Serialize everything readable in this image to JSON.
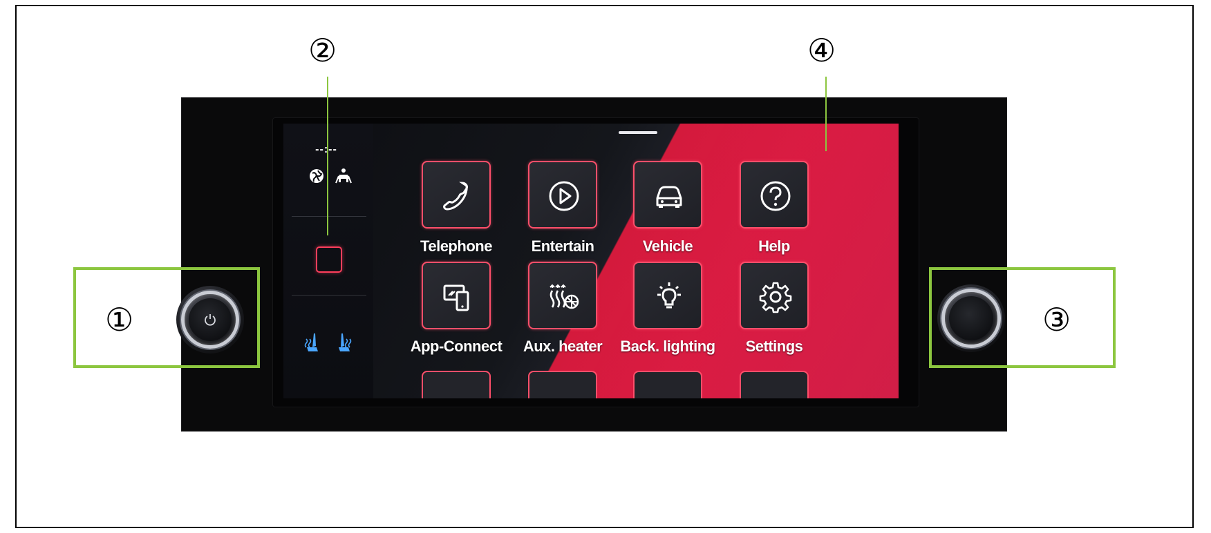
{
  "callouts": {
    "one": "①",
    "two": "②",
    "three": "③",
    "four": "④"
  },
  "colors": {
    "callout_green": "#8cc63f",
    "tile_border": "#ff4f6a",
    "screen_red": "#e31d45",
    "seat_icon_blue": "#4aa6ff"
  },
  "sidebar": {
    "time": "--:--",
    "icons": [
      "globe-icon",
      "traffic-assist-icon"
    ],
    "seat_icons": [
      "seat-heater-left-icon",
      "seat-heater-right-icon"
    ]
  },
  "apps": [
    {
      "label": "Telephone",
      "icon": "phone-icon"
    },
    {
      "label": "Entertain",
      "icon": "play-icon"
    },
    {
      "label": "Vehicle",
      "icon": "car-icon"
    },
    {
      "label": "Help",
      "icon": "help-icon"
    },
    {
      "label": "App-Connect",
      "icon": "app-connect-icon"
    },
    {
      "label": "Aux. heater",
      "icon": "aux-heater-icon"
    },
    {
      "label": "Back. lighting",
      "icon": "lightbulb-icon"
    },
    {
      "label": "Settings",
      "icon": "gear-icon"
    }
  ],
  "knobs": {
    "left": "power-volume-knob",
    "right": "tuning-knob"
  }
}
